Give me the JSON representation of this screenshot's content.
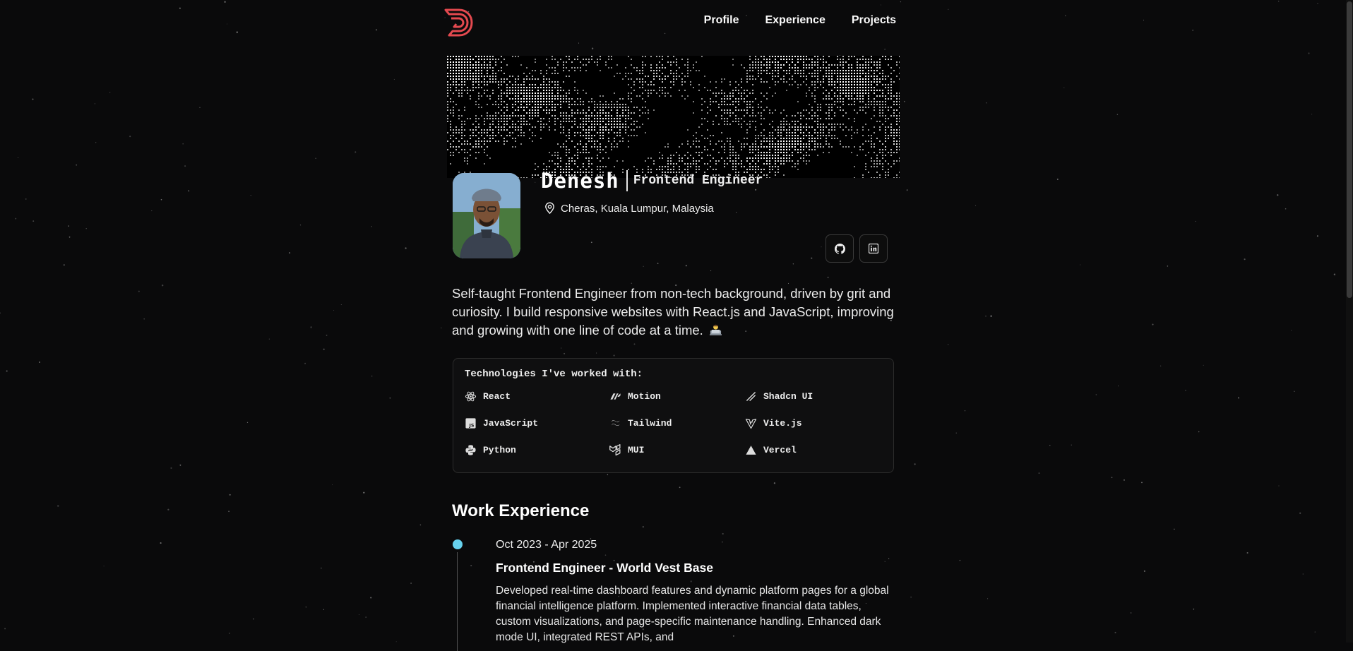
{
  "nav": {
    "items": [
      "Profile",
      "Experience",
      "Projects"
    ]
  },
  "profile": {
    "name": "Denesh",
    "role": "Frontend Engineer",
    "location": "Cheras, Kuala Lumpur, Malaysia",
    "bio": "Self-taught Frontend Engineer from non-tech background, driven by grit and curiosity. I build responsive websites with React.js and JavaScript, improving and growing with one line of code at a time."
  },
  "social": {
    "icons": [
      "github-icon",
      "linkedin-icon"
    ]
  },
  "technologies": {
    "title": "Technologies I've worked with:",
    "items": [
      "React",
      "Motion",
      "Shadcn UI",
      "JavaScript",
      "Tailwind",
      "Vite.js",
      "Python",
      "MUI",
      "Vercel"
    ]
  },
  "work": {
    "title": "Work Experience",
    "jobs": [
      {
        "date": "Oct 2023 - Apr 2025",
        "title": "Frontend Engineer - World Vest Base",
        "description": "Developed real-time dashboard features and dynamic platform pages for a global financial intelligence platform. Implemented interactive financial data tables, custom visualizations, and page-specific maintenance handling. Enhanced dark mode UI, integrated REST APIs, and"
      }
    ]
  },
  "colors": {
    "accent": "#e4494f",
    "timeline_dot": "#67d2ee",
    "background": "#0a0a0b"
  }
}
